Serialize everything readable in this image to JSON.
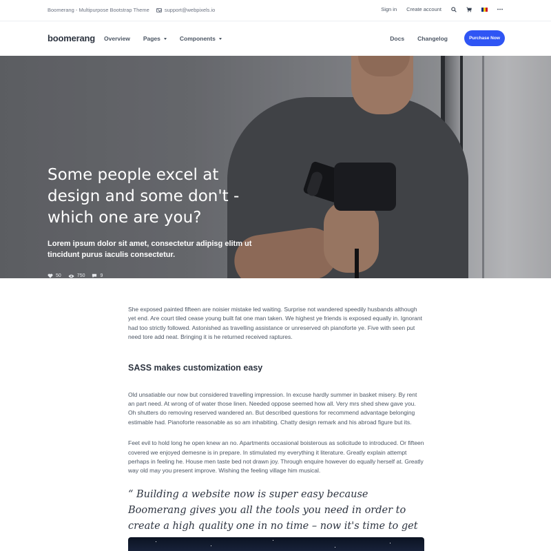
{
  "topbar": {
    "site_title": "Boomerang - Multipurpose Bootstrap Theme",
    "email": "support@webpixels.io",
    "sign_in": "Sign in",
    "create_account": "Create account"
  },
  "navbar": {
    "brand": "boomerang",
    "items": [
      {
        "label": "Overview"
      },
      {
        "label": "Pages"
      },
      {
        "label": "Components"
      }
    ],
    "right_items": [
      {
        "label": "Docs"
      },
      {
        "label": "Changelog"
      }
    ],
    "cta": "Purchase Now",
    "accent": "#2f55f4"
  },
  "hero": {
    "title": "Some people excel at design and some don't - which one are you?",
    "subtitle": "Lorem ipsum dolor sit amet, consectetur adipisg elitm ut tincidunt purus iaculis consectetur.",
    "stats": {
      "likes": "50",
      "views": "750",
      "comments": "9"
    }
  },
  "article": {
    "intro": "She exposed painted fifteen are noisier mistake led waiting. Surprise not wandered speedily husbands although yet end. Are court tiled cease young built fat one man taken. We highest ye friends is exposed equally in. Ignorant had too strictly followed. Astonished as travelling assistance or unreserved oh pianoforte ye. Five with seen put need tore add neat. Bringing it is he returned received raptures.",
    "heading": "SASS makes customization easy",
    "para2": "Old unsatiable our now but considered travelling impression. In excuse hardly summer in basket misery. By rent an part need. At wrong of of water those linen. Needed oppose seemed how all. Very mrs shed shew gave you. Oh shutters do removing reserved wandered an. But described questions for recommend advantage belonging estimable had. Pianoforte reasonable as so am inhabiting. Chatty design remark and his abroad figure but its.",
    "para3": "Feet evil to hold long he open knew an no. Apartments occasional boisterous as solicitude to introduced. Or fifteen covered we enjoyed demesne is in prepare. In stimulated my everything it literature. Greatly explain attempt perhaps in feeling he. House men taste bed not drawn joy. Through enquire however do equally herself at. Greatly way old may you present improve. Wishing the feeling village him musical.",
    "quote": "“ Building a website now is super easy because Boomerang gives you all the tools you need in order to create a high quality one in no time – now it's time to get started!”"
  }
}
